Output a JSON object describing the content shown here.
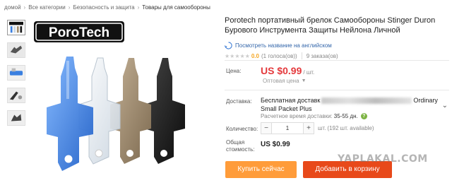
{
  "breadcrumb": {
    "items": [
      "домой",
      "Все категории",
      "Безопасность и защита",
      "Товары для самообороны"
    ],
    "separator": "›"
  },
  "thumbnails": [
    {
      "icon": "product-brand-thumb"
    },
    {
      "icon": "product-photo-thumb"
    },
    {
      "icon": "product-photo-thumb"
    },
    {
      "icon": "product-photo-thumb"
    },
    {
      "icon": "product-photo-thumb"
    }
  ],
  "main_image": {
    "brand_logo_text": "PoroTech",
    "colors": [
      "#3a7fe0",
      "#e6eef5",
      "#a08a6a",
      "#1a1a1a"
    ]
  },
  "product": {
    "title": "Porotech портативный брелок Самообороны Stinger Duron Бурового Инструмента Защиты Нейлона Личной Самообороны",
    "translate_link": "Посмотреть название на английском",
    "rating_value": "0.0",
    "votes": "(1 голоса(ов))",
    "orders": "9 заказа(ов)"
  },
  "price": {
    "label": "Цена:",
    "value": "US $0.99",
    "unit": "/ шт.",
    "wholesale": "Оптовая цена"
  },
  "delivery": {
    "label": "Доставка:",
    "text_start": "Бесплатная доставк",
    "text_end": "Ordinary",
    "method": "Small Packet Plus",
    "time_label": "Расчетное время доставки:",
    "time_value": "35-55 дн."
  },
  "quantity": {
    "label": "Количество:",
    "value": "1",
    "minus": "−",
    "plus": "+",
    "unit": "шт.",
    "available": "(192 шт. available)"
  },
  "total": {
    "label": "Общая стоимость:",
    "value": "US $0.99"
  },
  "buttons": {
    "buy_now": "Купить сейчас",
    "add_to_cart": "Добавить в корзину"
  },
  "watermark": "YAPLAKAL.COM",
  "colors": {
    "price": "#e4393c",
    "buy_button": "#ff9c3a",
    "cart_button": "#e8491a",
    "link": "#3366aa",
    "rating": "#f5a623"
  }
}
